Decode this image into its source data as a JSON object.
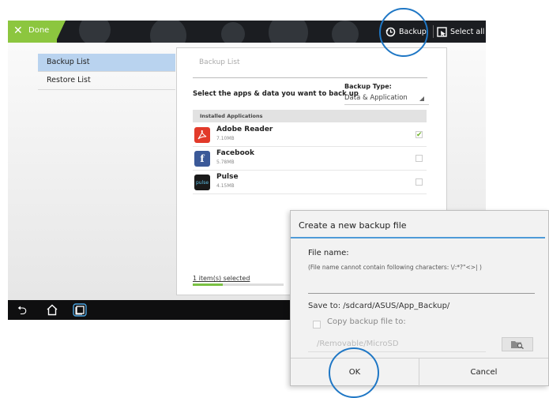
{
  "colors": {
    "accent": "#8cc63f",
    "annotation": "#1f77c5",
    "dialog_rule": "#4f9bd8",
    "selected_row": "#b9d3ef"
  },
  "topbar": {
    "done_icon": "close-icon",
    "done_label": "Done",
    "backup_icon": "backup-history-icon",
    "backup_label": "Backup",
    "select_all_icon": "select-all-icon",
    "select_all_label": "Select all"
  },
  "sidebar": {
    "items": [
      {
        "label": "Backup List",
        "selected": true
      },
      {
        "label": "Restore List",
        "selected": false
      }
    ]
  },
  "card": {
    "title": "Backup List",
    "select_prompt": "Select the apps & data you want to back up",
    "backup_type_label": "Backup Type:",
    "backup_type_value": "Data & Application",
    "section_header": "Installed Applications",
    "apps": [
      {
        "name": "Adobe Reader",
        "size": "7.10MB",
        "icon": "adobe-reader-icon",
        "icon_text": "",
        "checked": true
      },
      {
        "name": "Facebook",
        "size": "5.78MB",
        "icon": "facebook-icon",
        "icon_text": "f",
        "checked": false
      },
      {
        "name": "Pulse",
        "size": "4.15MB",
        "icon": "pulse-icon",
        "icon_text": "pulse",
        "checked": false
      }
    ],
    "selected_count": "1 item(s) selected",
    "progress": 0.33
  },
  "navbar": {
    "back_icon": "back-icon",
    "home_icon": "home-icon",
    "recent_icon": "recent-apps-icon"
  },
  "dialog": {
    "title": "Create a new backup file",
    "file_name_label": "File name:",
    "file_name_hint": "(File name cannot contain following characters: \\/:*?\"<>| )",
    "file_name_value": "",
    "save_to": "Save to:  /sdcard/ASUS/App_Backup/",
    "copy_label": "Copy backup file to:",
    "removable_path": "/Removable/MicroSD",
    "folder_icon": "folder-browse-icon",
    "ok_label": "OK",
    "cancel_label": "Cancel"
  }
}
